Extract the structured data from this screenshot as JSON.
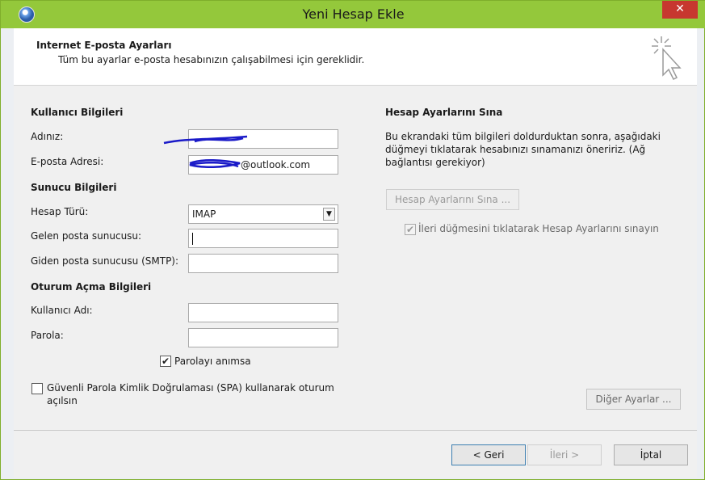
{
  "window": {
    "title": "Yeni Hesap Ekle",
    "close_label": "✕"
  },
  "header": {
    "title": "Internet E-posta Ayarları",
    "subtitle": "Tüm bu ayarlar e-posta hesabınızın çalışabilmesi için gereklidir."
  },
  "user_info": {
    "section_label": "Kullanıcı Bilgileri",
    "name_label": "Adınız:",
    "name_value": "",
    "email_label": "E-posta Adresi:",
    "email_value": "@outlook.com"
  },
  "server_info": {
    "section_label": "Sunucu Bilgileri",
    "account_type_label": "Hesap Türü:",
    "account_type_value": "IMAP",
    "incoming_label": "Gelen posta sunucusu:",
    "incoming_value": "",
    "outgoing_label": "Giden posta sunucusu (SMTP):",
    "outgoing_value": ""
  },
  "logon_info": {
    "section_label": "Oturum Açma Bilgileri",
    "username_label": "Kullanıcı Adı:",
    "username_value": "",
    "password_label": "Parola:",
    "password_value": "",
    "remember_password_label": "Parolayı anımsa",
    "remember_password_checked": true,
    "spa_label_line1": "Güvenli Parola Kimlik Doğrulaması (SPA) kullanarak oturum",
    "spa_label_line2": "açılsın",
    "spa_checked": false
  },
  "test_settings": {
    "section_label": "Hesap Ayarlarını Sına",
    "description_line1": "Bu ekrandaki tüm bilgileri doldurduktan sonra, aşağıdaki",
    "description_line2": "düğmeyi tıklatarak hesabınızı sınamanızı öneririz. (Ağ",
    "description_line3": "bağlantısı gerekiyor)",
    "test_button_label": "Hesap Ayarlarını Sına ...",
    "auto_test_label": "İleri düğmesini tıklatarak Hesap Ayarlarını sınayın",
    "auto_test_checked": true,
    "more_settings_label": "Diğer Ayarlar ..."
  },
  "footer": {
    "back_label": "< Geri",
    "next_label": "İleri >",
    "cancel_label": "İptal"
  },
  "colors": {
    "titlebar": "#94c83b",
    "close": "#c7372f",
    "scribble": "#1a1ac8"
  },
  "icons": {
    "app": "outlook-globe-icon",
    "wizard": "magic-wand-cursor-icon",
    "check": "checkmark-icon",
    "dropdown": "chevron-down-icon"
  }
}
